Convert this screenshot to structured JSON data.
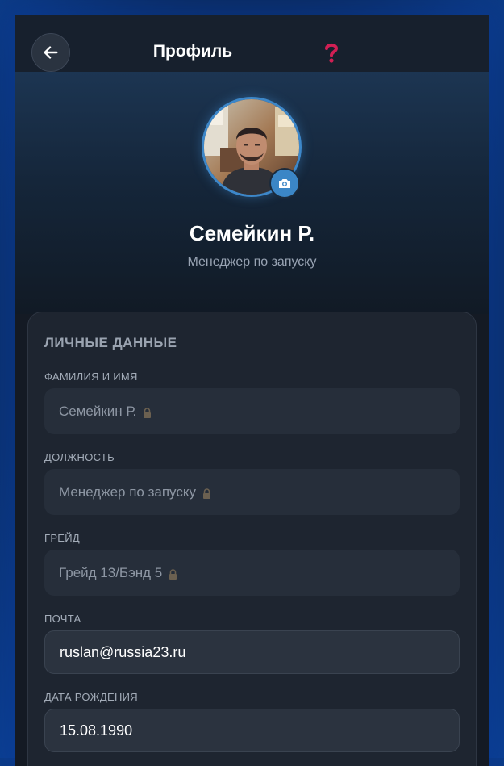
{
  "header": {
    "title": "Профиль",
    "back_icon": "arrow-left-icon",
    "help_icon": "question-mark-icon"
  },
  "profile": {
    "name": "Семейкин Р.",
    "role": "Менеджер по запуску",
    "avatar": "user-photo",
    "camera_icon": "camera-icon"
  },
  "personal": {
    "section_title": "ЛИЧНЫЕ ДАННЫЕ",
    "fields": [
      {
        "label": "ФАМИЛИЯ И ИМЯ",
        "value": "Семейкин Р.",
        "locked": true
      },
      {
        "label": "ДОЛЖНОСТЬ",
        "value": "Менеджер по запуску",
        "locked": true
      },
      {
        "label": "ГРЕЙД",
        "value": "Грейд 13/Бэнд 5",
        "locked": true
      },
      {
        "label": "ПОЧТА",
        "value": "ruslan@russia23.ru",
        "locked": false
      },
      {
        "label": "ДАТА РОЖДЕНИЯ",
        "value": "15.08.1990",
        "locked": false
      }
    ]
  },
  "colors": {
    "accent": "#3b86c6",
    "help": "#d11f54",
    "background": "#141a24",
    "card": "#1e2530"
  }
}
